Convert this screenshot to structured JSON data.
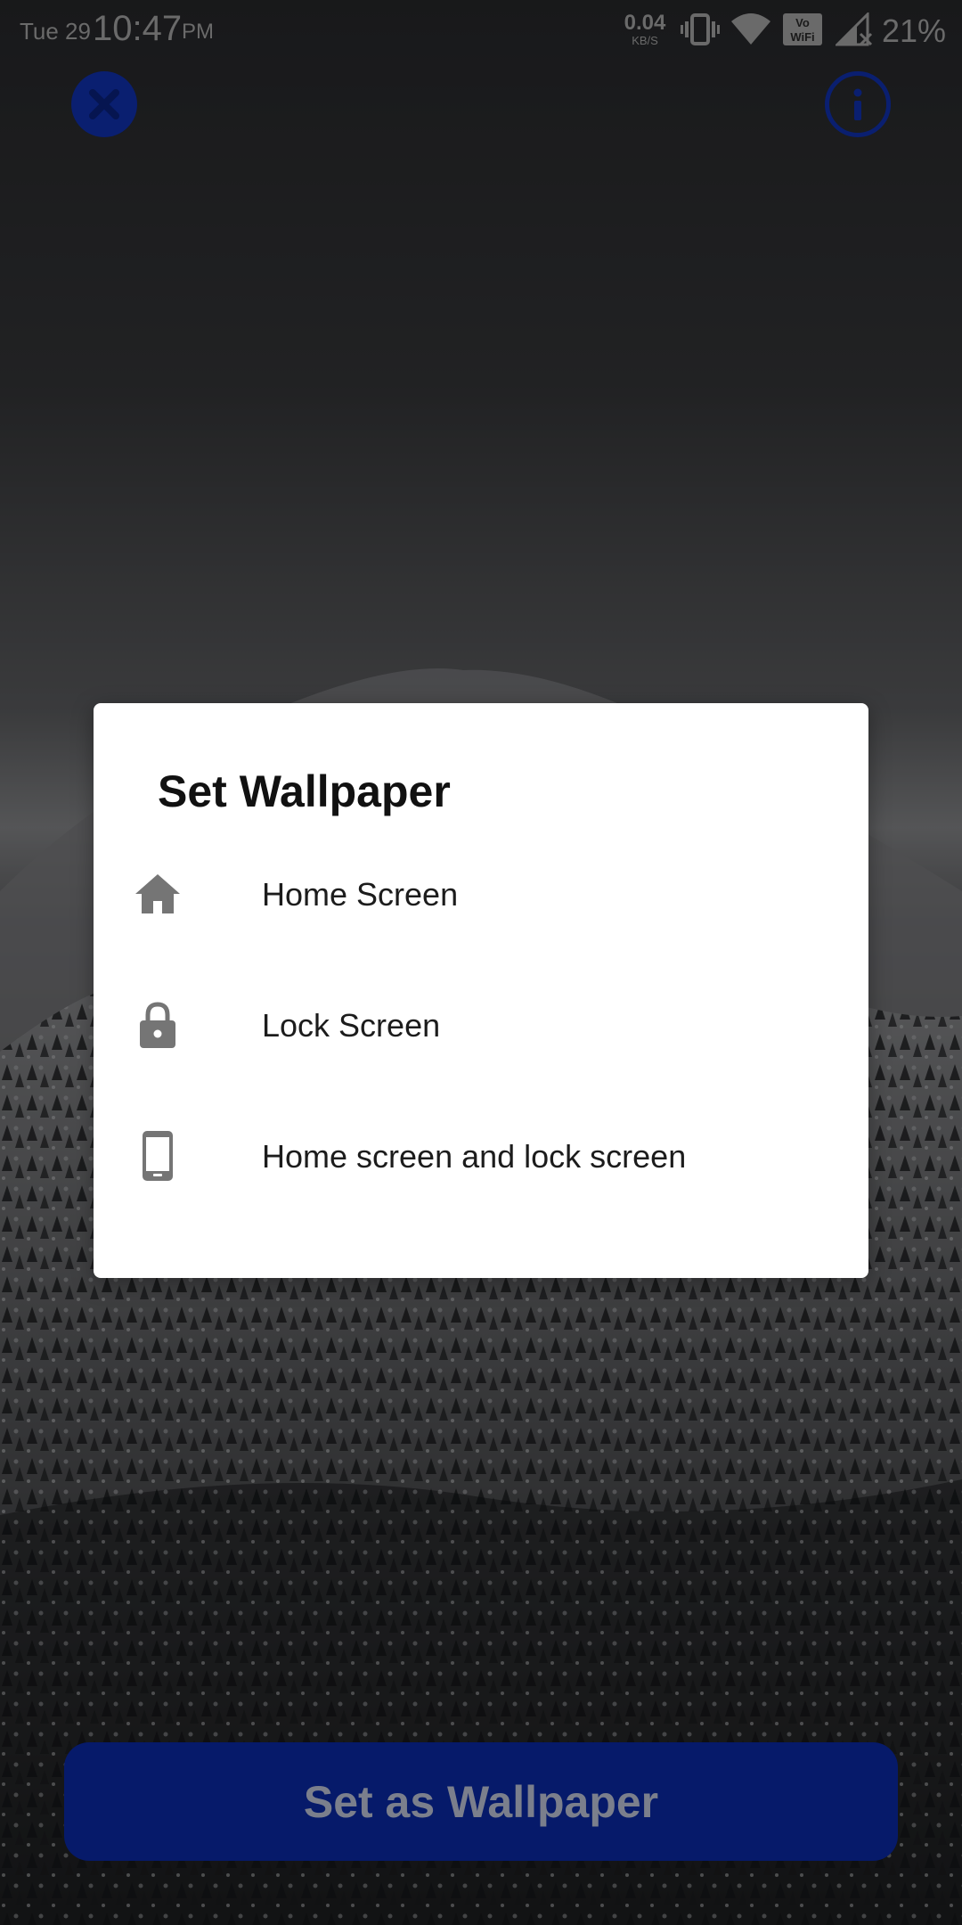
{
  "status_bar": {
    "date": "Tue 29",
    "time": "10:47",
    "ampm": "PM",
    "net_speed_value": "0.04",
    "net_speed_unit": "KB/S",
    "battery": "21%"
  },
  "top_bar": {
    "close_icon": "close-icon",
    "info_icon": "info-icon",
    "accent_color": "#0a1f70"
  },
  "dialog": {
    "title": "Set Wallpaper",
    "options": [
      {
        "label": "Home Screen",
        "icon": "home-icon"
      },
      {
        "label": "Lock Screen",
        "icon": "lock-icon"
      },
      {
        "label": "Home screen and lock screen",
        "icon": "phone-icon"
      }
    ]
  },
  "bottom": {
    "button_label": "Set as Wallpaper",
    "button_color": "#061a6a"
  }
}
